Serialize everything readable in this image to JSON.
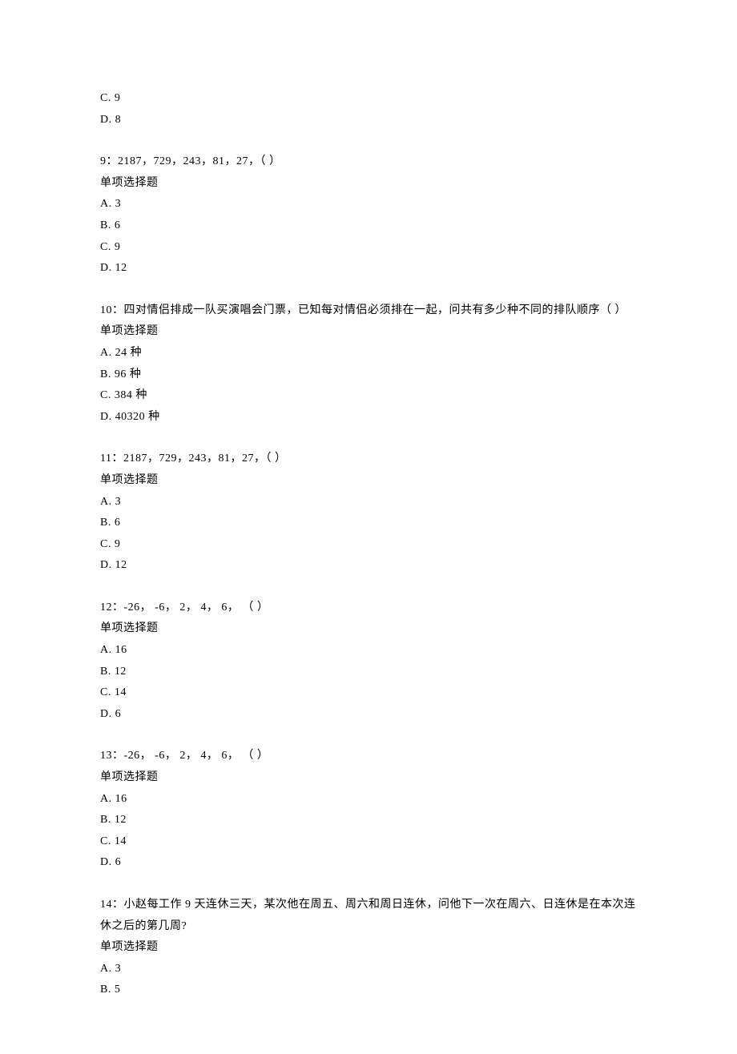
{
  "top_options": [
    {
      "label": "C.",
      "text": "9"
    },
    {
      "label": "D.",
      "text": "8"
    }
  ],
  "questions": [
    {
      "number": "9：",
      "stem": "2187，729，243，81，27，（ ）",
      "type": "单项选择题",
      "options": [
        {
          "label": "A.",
          "text": "3"
        },
        {
          "label": "B.",
          "text": "6"
        },
        {
          "label": "C.",
          "text": "9"
        },
        {
          "label": "D.",
          "text": "12"
        }
      ]
    },
    {
      "number": "10：",
      "stem": "四对情侣排成一队买演唱会门票，已知每对情侣必须排在一起，问共有多少种不同的排队顺序（ ）",
      "type": "单项选择题",
      "options": [
        {
          "label": "A.",
          "text": "24 种"
        },
        {
          "label": "B.",
          "text": "96 种"
        },
        {
          "label": "C.",
          "text": "384 种"
        },
        {
          "label": "D.",
          "text": "40320 种"
        }
      ]
    },
    {
      "number": "11：",
      "stem": "2187，729，243，81，27，（ ）",
      "type": "单项选择题",
      "options": [
        {
          "label": "A.",
          "text": "3"
        },
        {
          "label": "B.",
          "text": "6"
        },
        {
          "label": "C.",
          "text": "9"
        },
        {
          "label": "D.",
          "text": "12"
        }
      ]
    },
    {
      "number": "12：",
      "stem": "-26， -6， 2， 4， 6， （ ）",
      "type": "单项选择题",
      "options": [
        {
          "label": "A.",
          "text": "16"
        },
        {
          "label": "B.",
          "text": "12"
        },
        {
          "label": "C.",
          "text": "14"
        },
        {
          "label": "D.",
          "text": "6"
        }
      ]
    },
    {
      "number": "13：",
      "stem": "-26， -6， 2， 4， 6， （ ）",
      "type": "单项选择题",
      "options": [
        {
          "label": "A.",
          "text": "16"
        },
        {
          "label": "B.",
          "text": "12"
        },
        {
          "label": "C.",
          "text": "14"
        },
        {
          "label": "D.",
          "text": "6"
        }
      ]
    },
    {
      "number": "14：",
      "stem": "小赵每工作 9 天连休三天，某次他在周五、周六和周日连休，问他下一次在周六、日连休是在本次连休之后的第几周?",
      "type": "单项选择题",
      "options": [
        {
          "label": "A.",
          "text": "3"
        },
        {
          "label": "B.",
          "text": "5"
        }
      ]
    }
  ]
}
